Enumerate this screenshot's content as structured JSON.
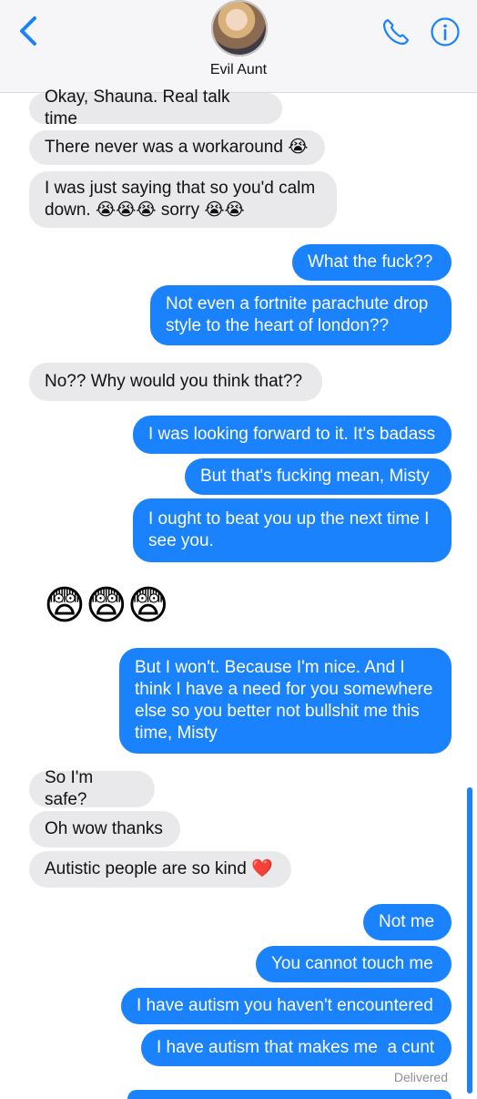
{
  "header": {
    "contact_name": "Evil Aunt",
    "icons": [
      "back-chevron-icon",
      "phone-icon",
      "info-icon"
    ],
    "accent": "#1982fc"
  },
  "messages": [
    {
      "dir": "in",
      "text": "Okay, Shauna. Real talk time"
    },
    {
      "dir": "in",
      "text": "There never was a workaround 😭"
    },
    {
      "dir": "in",
      "text": "I was just saying that so you'd calm\ndown. 😭😭😭 sorry 😭😭"
    },
    {
      "dir": "out",
      "text": "What the fuck??"
    },
    {
      "dir": "out",
      "text": "Not even a fortnite parachute drop\nstyle to the heart of london??"
    },
    {
      "dir": "in",
      "text": "No?? Why would you think that??"
    },
    {
      "dir": "out",
      "text": "I was looking forward to it. It's badass"
    },
    {
      "dir": "out",
      "text": "But that's fucking mean, Misty"
    },
    {
      "dir": "out",
      "text": "I ought to beat you up the next time I\nsee you."
    },
    {
      "dir": "in",
      "text": "😨😨😨",
      "emoji_only": true
    },
    {
      "dir": "out",
      "text": "But I won't. Because I'm nice. And I\nthink I have a need for you somewhere\nelse so you better not bullshit me this\ntime, Misty"
    },
    {
      "dir": "in",
      "text": "So I'm safe?"
    },
    {
      "dir": "in",
      "text": "Oh wow thanks"
    },
    {
      "dir": "in",
      "text": "Autistic people are so kind ❤️"
    },
    {
      "dir": "out",
      "text": "Not me"
    },
    {
      "dir": "out",
      "text": "You cannot touch me"
    },
    {
      "dir": "out",
      "text": "I have autism you haven't encountered"
    },
    {
      "dir": "out",
      "text": "I have autism that makes me  a cunt"
    }
  ],
  "status": {
    "delivered": "Delivered"
  },
  "colors": {
    "incoming_bubble": "#e9e9eb",
    "outgoing_bubble": "#1982fc",
    "status_text": "#8e8e93"
  }
}
